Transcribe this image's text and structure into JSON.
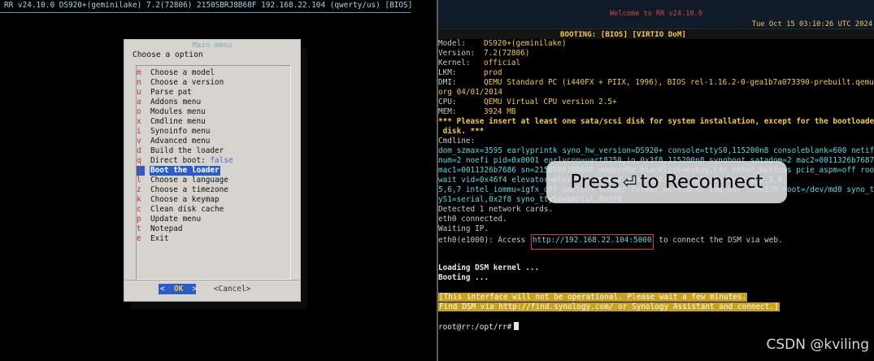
{
  "left_terminal": {
    "header": "RR v24.10.0 DS920+(geminilake) 7.2(72806) 2150SBRJ8B68F 192.168.22.104 (qwerty/us) [BIOS]"
  },
  "dialog": {
    "title": "Main menu",
    "prompt": "Choose a option",
    "items": [
      {
        "key": "m",
        "label": "Choose a model"
      },
      {
        "key": "n",
        "label": "Choose a version"
      },
      {
        "key": "u",
        "label": "Parse pat"
      },
      {
        "key": "a",
        "label": "Addons menu"
      },
      {
        "key": "o",
        "label": "Modules menu"
      },
      {
        "key": "x",
        "label": "Cmdline menu"
      },
      {
        "key": "i",
        "label": "Synoinfo menu"
      },
      {
        "key": "v",
        "label": "Advanced menu"
      },
      {
        "key": "d",
        "label": "Build the loader"
      },
      {
        "key": "q",
        "label": "Direct boot:",
        "value": "false"
      },
      {
        "key": "b",
        "label": "Boot the loader",
        "selected": true
      },
      {
        "key": "l",
        "label": "Choose a language"
      },
      {
        "key": "z",
        "label": "Choose a timezone"
      },
      {
        "key": "k",
        "label": "Choose a keymap"
      },
      {
        "key": "c",
        "label": "Clean disk cache"
      },
      {
        "key": "p",
        "label": "Update menu"
      },
      {
        "key": "t",
        "label": "Notepad"
      },
      {
        "key": "e",
        "label": "Exit"
      }
    ],
    "ok_label": "OK",
    "cancel_label": "<Cancel>"
  },
  "right_terminal": {
    "welcome": "Welcome to RR v24.10.0",
    "datetime": "Tue Oct 15 03:10:26 UTC 2024",
    "booting_line": "BOOTING: [BIOS] [VIRTIO DoM]",
    "model_label": "Model:",
    "model_value": "DS920+(geminilake)",
    "version_label": "Version:",
    "version_value": "7.2(72806)",
    "kernel_label": "Kernel:",
    "kernel_value": "official",
    "lkm_label": "LKM:",
    "lkm_value": "prod",
    "dmi_label": "DMI:",
    "dmi_value_1": "QEMU Standard PC (i440FX + PIIX, 1996), BIOS rel-1.16.2-0-gea1b7a073390-prebuilt.qemu.",
    "dmi_value_2": "org 04/01/2014",
    "cpu_label": "CPU:",
    "cpu_value": "QEMU Virtual CPU version 2.5+",
    "mem_label": "MEM:",
    "mem_value": "3924 MB",
    "warning_1": "*** Please insert at least one sata/scsi disk for system installation, except for the bootloader",
    "warning_2": " disk. ***",
    "cmdline_label": "Cmdline:",
    "cmdline_1": "dom_szmax=3595 earlyprintk syno_hw_version=DS920+ console=ttyS0,115200n8 consoleblank=600 netif_",
    "cmdline_2": "num=2 noefi pid=0x0001 earlycon=uart8250,io,0x3f8,115200n8 synoboot_satadom=2 mac2=0011326b7687",
    "cmdline_3": "mac1=0011326b7686 sn=2150SBRJ8B68F modprobe.blacklist=evbug,cdc_ether,mpt3sas pcie_aspm=off root",
    "cmdline_4": "wait vid=0x46f4 elevator=elevator pm_ipd_mask=0x0 mk=7 interfaces=0,1,2,3,4,",
    "cmdline_5": "5,6,7 intel_iommu=igfx_off panic=5 vender_format_version=2 log_buf_len=32M root=/dev/md0 syno_tt",
    "cmdline_6": "yS1=serial,0x2f8 syno_ttyS0=serial,0x3f8",
    "detected": "Detected 1 network cards.",
    "eth_connected": "eth0 connected.",
    "waiting_ip": "Waiting IP.",
    "access_prefix": "eth0(e1000): Access",
    "access_url": "http://192.168.22.104:5000",
    "access_suffix": "to connect the DSM via web.",
    "loading_kernel": "Loading DSM kernel ...",
    "booting": "Booting ...",
    "notice_1": "[This interface will not be operational. Please wait a few minutes.",
    "notice_2": "Find DSM via http://find.synology.com/ or Synology Assistant and connect.]",
    "prompt": "root@rr:/opt/rr#"
  },
  "overlay": {
    "pre": "Press",
    "post": "to Reconnect",
    "icon": "return-key-icon"
  },
  "watermark": "CSDN @kviling",
  "colors": {
    "accent_blue": "#2b5cc8",
    "hotkey_red": "#c0342b",
    "term_yellow": "#f2c84b",
    "term_cyan": "#60d5e0",
    "url_box_red": "#e03a3a"
  }
}
